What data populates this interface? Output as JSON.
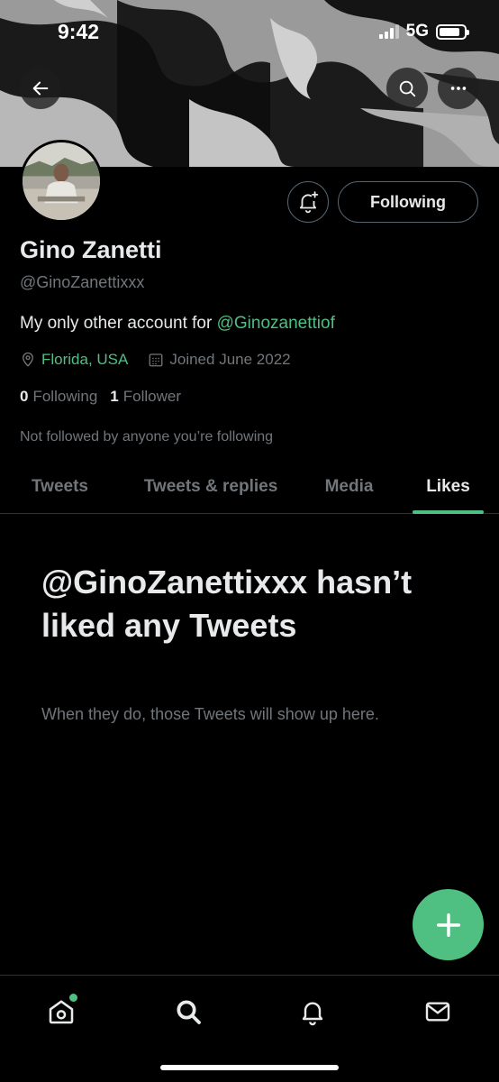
{
  "status_bar": {
    "time": "9:42",
    "network": "5G"
  },
  "header": {
    "back_icon": "arrow-left-icon",
    "search_icon": "search-icon",
    "more_icon": "more-horizontal-icon"
  },
  "profile": {
    "name": "Gino Zanetti",
    "handle": "@GinoZanettixxx",
    "bio_text": "My only other account for ",
    "bio_link": "@Ginozanettiof",
    "location": "Florida, USA",
    "joined": "Joined June 2022",
    "following_count": "0",
    "following_label": "Following",
    "followers_count": "1",
    "followers_label": "Follower",
    "not_followed_text": "Not followed by anyone you’re following"
  },
  "actions": {
    "notify_icon": "bell-plus-icon",
    "following_button": "Following"
  },
  "tabs": [
    {
      "label": "Tweets",
      "active": false
    },
    {
      "label": "Tweets & replies",
      "active": false
    },
    {
      "label": "Media",
      "active": false
    },
    {
      "label": "Likes",
      "active": true
    }
  ],
  "empty_state": {
    "title": "@GinoZanettixxx hasn’t liked any Tweets",
    "subtitle": "When they do, those Tweets will show up here."
  },
  "fab": {
    "icon": "plus-icon"
  },
  "bottom_nav": [
    {
      "name": "home",
      "icon": "home-icon",
      "has_dot": true
    },
    {
      "name": "search",
      "icon": "search-icon",
      "has_dot": false
    },
    {
      "name": "notifications",
      "icon": "bell-icon",
      "has_dot": false
    },
    {
      "name": "messages",
      "icon": "mail-icon",
      "has_dot": false
    }
  ],
  "colors": {
    "accent": "#4fbf82",
    "background": "#000000",
    "muted_text": "#71767b",
    "border": "#2f3336"
  }
}
